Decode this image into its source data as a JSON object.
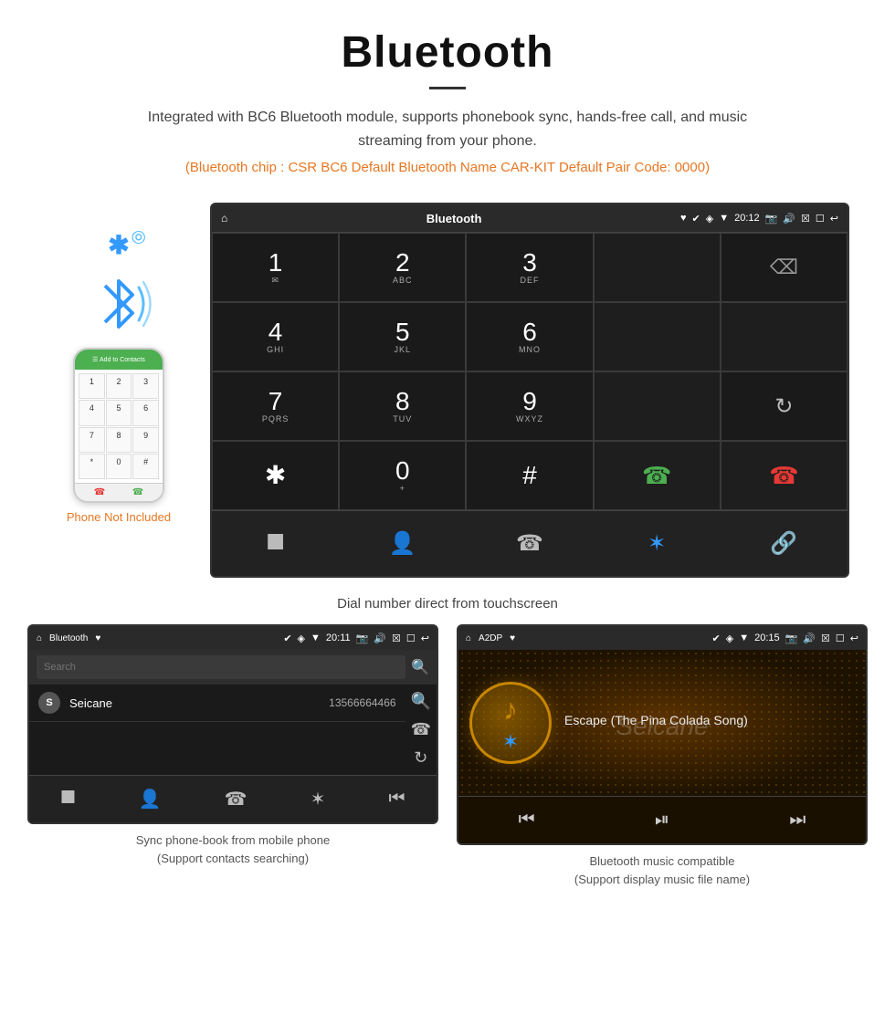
{
  "header": {
    "title": "Bluetooth",
    "description": "Integrated with BC6 Bluetooth module, supports phonebook sync, hands-free call, and music streaming from your phone.",
    "specs": "(Bluetooth chip : CSR BC6    Default Bluetooth Name CAR-KIT    Default Pair Code: 0000)"
  },
  "main_screen": {
    "status_bar": {
      "left_icon": "home",
      "center_label": "Bluetooth",
      "usb_icon": "usb",
      "time": "20:12",
      "camera_icon": "camera",
      "volume_icon": "volume",
      "close_icon": "close",
      "window_icon": "window",
      "back_icon": "back"
    },
    "dial_keys": [
      {
        "num": "1",
        "sub": "⌂"
      },
      {
        "num": "2",
        "sub": "ABC"
      },
      {
        "num": "3",
        "sub": "DEF"
      },
      {
        "num": "",
        "sub": ""
      },
      {
        "num": "⌫",
        "sub": ""
      },
      {
        "num": "4",
        "sub": "GHI"
      },
      {
        "num": "5",
        "sub": "JKL"
      },
      {
        "num": "6",
        "sub": "MNO"
      },
      {
        "num": "",
        "sub": ""
      },
      {
        "num": "",
        "sub": ""
      },
      {
        "num": "7",
        "sub": "PQRS"
      },
      {
        "num": "8",
        "sub": "TUV"
      },
      {
        "num": "9",
        "sub": "WXYZ"
      },
      {
        "num": "",
        "sub": ""
      },
      {
        "num": "↺",
        "sub": ""
      },
      {
        "num": "✱",
        "sub": ""
      },
      {
        "num": "0",
        "sub": "+"
      },
      {
        "num": "#",
        "sub": ""
      },
      {
        "num": "📞",
        "sub": ""
      },
      {
        "num": "📞end",
        "sub": ""
      }
    ],
    "bottom_icons": [
      "grid",
      "person",
      "phone",
      "bluetooth",
      "link"
    ]
  },
  "main_caption": "Dial number direct from touchscreen",
  "phone_side": {
    "not_included_label": "Phone Not Included",
    "bluetooth_label": "Bluetooth"
  },
  "phonebook_screen": {
    "status_label": "Bluetooth",
    "time": "20:11",
    "search_placeholder": "Search",
    "contact": {
      "letter": "S",
      "name": "Seicane",
      "number": "13566664466"
    },
    "bottom_icons": [
      "grid",
      "person",
      "phone",
      "bluetooth",
      "prev"
    ]
  },
  "music_screen": {
    "status_label": "A2DP",
    "time": "20:15",
    "song_title": "Escape (The Pina Colada Song)",
    "bottom_icons": [
      "prev",
      "play",
      "next"
    ],
    "watermark": "Seicane"
  },
  "captions": {
    "phonebook": "Sync phone-book from mobile phone",
    "phonebook_sub": "(Support contacts searching)",
    "music": "Bluetooth music compatible",
    "music_sub": "(Support display music file name)"
  }
}
